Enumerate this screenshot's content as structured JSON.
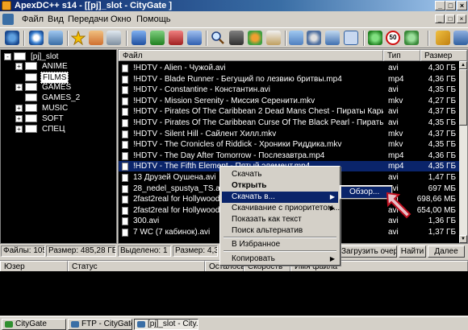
{
  "window": {
    "title": "ApexDC++ s14 - [[pj]_slot - CityGate  ]",
    "controls": [
      "_",
      "□",
      "×"
    ]
  },
  "menu": {
    "items": [
      "Файл",
      "Вид",
      "Передачи",
      "Окно",
      "Помощь"
    ],
    "mdi_controls": [
      "_",
      "□",
      "×"
    ]
  },
  "toolbar": {
    "icons": [
      "connect-icon",
      "reconnect-icon",
      "favorites-icon",
      "users-icon",
      "queue-icon",
      "finished-icon",
      "upload-icon",
      "search-icon",
      "spy-icon",
      "notepad-icon",
      "settings-icon",
      "network-icon",
      "away-icon",
      "limiter-icon",
      "stop-icon",
      "open-list-icon"
    ],
    "limit_badge": "50"
  },
  "tree": {
    "root": "[pj]_slot",
    "items": [
      {
        "label": "ANIME",
        "expandable": true,
        "selected": false
      },
      {
        "label": "FILMS",
        "expandable": false,
        "selected": true
      },
      {
        "label": "GAMES",
        "expandable": true,
        "selected": false
      },
      {
        "label": "GAMES_2",
        "expandable": false,
        "selected": false
      },
      {
        "label": "MUSIC",
        "expandable": true,
        "selected": false
      },
      {
        "label": "SOFT",
        "expandable": true,
        "selected": false
      },
      {
        "label": "СПЕЦ",
        "expandable": true,
        "selected": false
      }
    ]
  },
  "filelist": {
    "columns": [
      "Файл",
      "Тип",
      "Размер"
    ],
    "rows": [
      {
        "name": "!HDTV - Alien - Чужой.avi",
        "type": "avi",
        "size": "4,30 ГБ"
      },
      {
        "name": "!HDTV - Blade Runner - Бегущий по лезвию бритвы.mp4",
        "type": "mp4",
        "size": "4,36 ГБ"
      },
      {
        "name": "!HDTV - Constantine - Константин.avi",
        "type": "avi",
        "size": "4,35 ГБ"
      },
      {
        "name": "!HDTV - Mission Serenity - Миссия Серенити.mkv",
        "type": "mkv",
        "size": "4,27 ГБ"
      },
      {
        "name": "!HDTV - Pirates Of The Caribbean 2 Dead Mans Chest - Пираты Карибского Мо...",
        "type": "avi",
        "size": "4,37 ГБ"
      },
      {
        "name": "!HDTV - Pirates Of The Caribbean Curse Of The Black Pearl - Пираты Карибского...",
        "type": "avi",
        "size": "4,35 ГБ"
      },
      {
        "name": "!HDTV - Silent Hill - Сайлент Хилл.mkv",
        "type": "mkv",
        "size": "4,37 ГБ"
      },
      {
        "name": "!HDTV - The Cronicles of Riddick - Хроники Риддика.mkv",
        "type": "mkv",
        "size": "4,35 ГБ"
      },
      {
        "name": "!HDTV - The Day After Tomorrow - Послезавтра.mp4",
        "type": "mp4",
        "size": "4,36 ГБ"
      },
      {
        "name": "!HDTV - The Fifth Element - Пятый элемент.mp4",
        "type": "mp4",
        "size": "4,35 ГБ",
        "selected": true
      },
      {
        "name": "13 Друзей Оушена.avi",
        "type": "avi",
        "size": "1,47 ГБ"
      },
      {
        "name": "28_nedel_spustya_TS.avi",
        "type": "avi",
        "size": "697 МБ"
      },
      {
        "name": "2fast2real for Hollywood 2.avi",
        "type": "avi",
        "size": "698,66 МБ"
      },
      {
        "name": "2fast2real for Hollywood.avi",
        "type": "avi",
        "size": "654,00 МБ"
      },
      {
        "name": "300.avi",
        "type": "avi",
        "size": "1,36 ГБ"
      },
      {
        "name": "7 WC (7 кабинок).avi",
        "type": "avi",
        "size": "1,37 ГБ"
      }
    ]
  },
  "status": {
    "files": "Файлы: 10574",
    "size": "Размер: 485,28 ГБ",
    "selected": "Выделено: 1",
    "size2": "Размер: 4,35 ГБ",
    "queue_button": "Загрузить очередь",
    "find_button": "Найти",
    "next_button": "Далее"
  },
  "transfers": {
    "columns": [
      "Юзер",
      "Статус",
      "Осталось",
      "Скорость",
      "Имя файла"
    ]
  },
  "taskbar": {
    "tasks": [
      {
        "label": "CityGate",
        "color": "#2f8f2f"
      },
      {
        "label": "FTP - CityGate",
        "color": "#3a6ea5"
      },
      {
        "label": "[pj]_slot - City...",
        "color": "#3a6ea5",
        "active": true
      }
    ]
  },
  "context_menu": {
    "items": [
      {
        "label": "Скачать",
        "bold": false,
        "sub": false,
        "hl": false
      },
      {
        "label": "Открыть",
        "bold": true,
        "sub": false,
        "hl": false
      },
      {
        "label": "Скачать в...",
        "bold": false,
        "sub": true,
        "hl": true
      },
      {
        "label": "Скачивание с приоритетом...",
        "bold": false,
        "sub": true,
        "hl": false
      },
      {
        "label": "Показать как текст",
        "bold": false,
        "sub": false,
        "hl": false
      },
      {
        "label": "Поиск альтернатив",
        "bold": false,
        "sub": false,
        "hl": false
      },
      {
        "label": "В Избранное",
        "bold": false,
        "sub": false,
        "hl": false
      },
      {
        "label": "Копировать",
        "bold": false,
        "sub": true,
        "hl": false
      }
    ],
    "submenu": "Обзор..."
  }
}
